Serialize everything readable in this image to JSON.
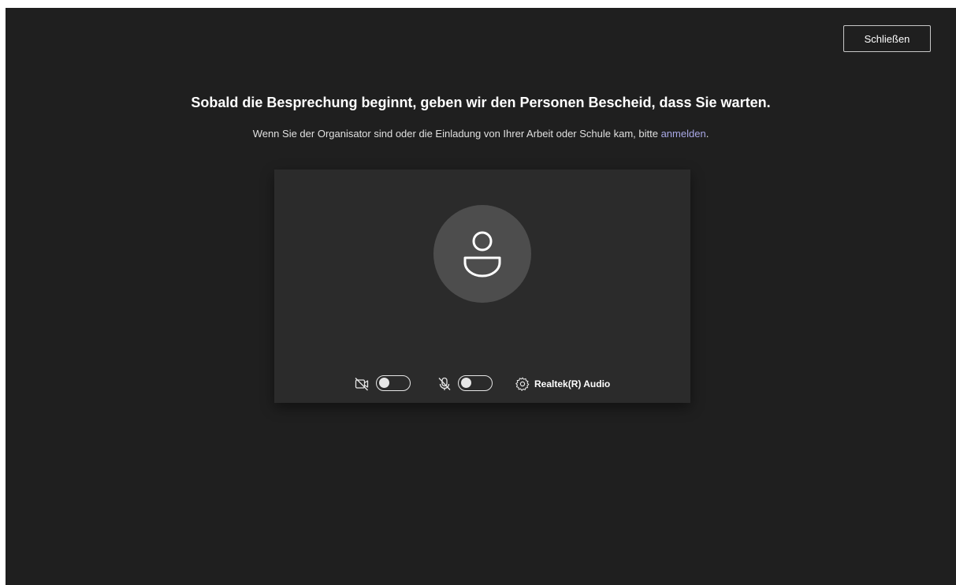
{
  "header": {
    "close_label": "Schließen"
  },
  "main": {
    "headline": "Sobald die Besprechung beginnt, geben wir den Personen Bescheid, dass Sie warten.",
    "subline_prefix": "Wenn Sie der Organisator sind oder die Einladung von Ihrer Arbeit oder Schule kam, bitte ",
    "signin_link": "anmelden",
    "subline_suffix": "."
  },
  "preview": {
    "avatar_icon": "person-icon",
    "camera": {
      "icon": "camera-off-icon",
      "enabled": false
    },
    "microphone": {
      "icon": "mic-off-icon",
      "enabled": false
    },
    "device": {
      "icon": "gear-icon",
      "label": "Realtek(R) Audio"
    }
  },
  "colors": {
    "background": "#1f1f1f",
    "panel": "#2b2b2b",
    "avatar": "#4d4d4d",
    "link": "#a9a8e6"
  }
}
